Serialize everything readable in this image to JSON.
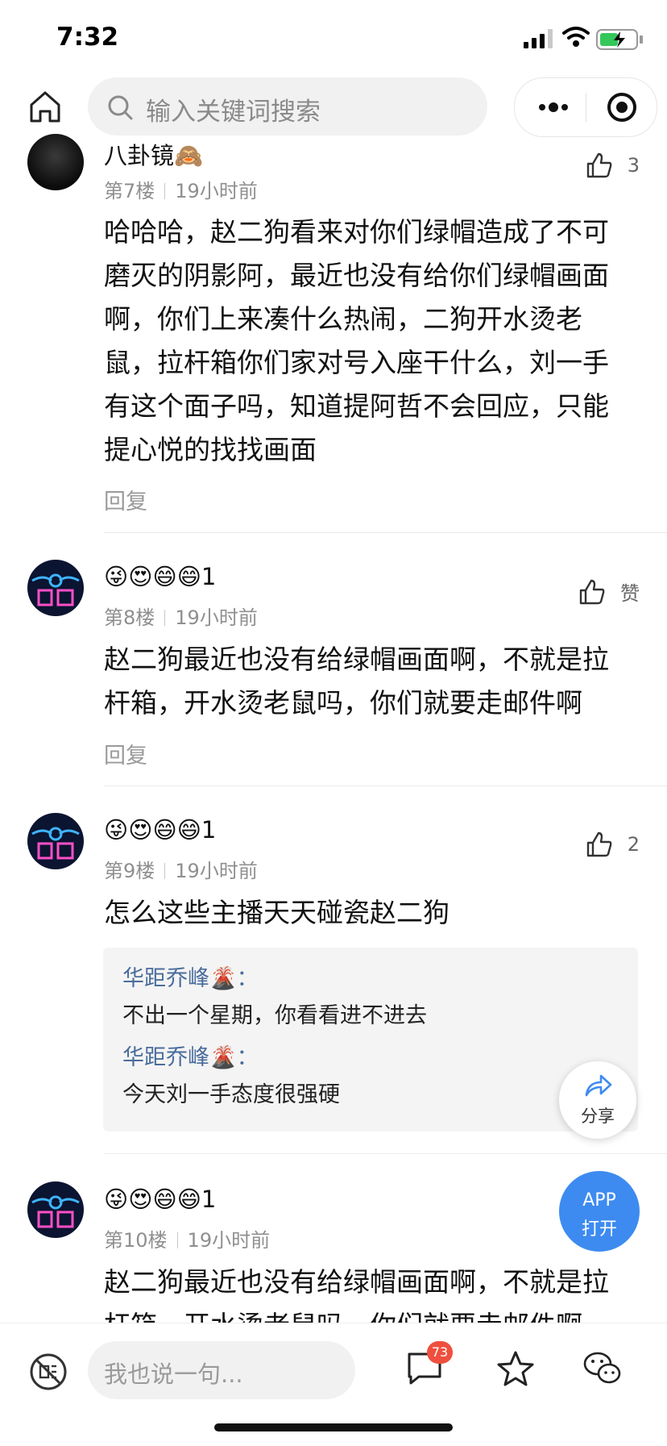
{
  "status_bar": {
    "time": "7:32"
  },
  "top_bar": {
    "search_placeholder": "输入关键词搜索"
  },
  "comments": [
    {
      "nickname": "八卦镜🙈",
      "floor": "第7楼",
      "time": "19小时前",
      "likes": "3",
      "text_lines": [
        "哈哈哈，赵二狗看来对你们绿帽造成了不可",
        "磨灭的阴影阿，最近也没有给你们绿帽画面",
        "啊，你们上来凑什么热闹，二狗开水烫老",
        "鼠，拉杆箱你们家对号入座干什么，刘一手",
        "有这个面子吗，知道提阿哲不会回应，只能",
        "提心悦的找找画面"
      ],
      "reply_label": "回复"
    },
    {
      "nickname": "😜😍😄😄1",
      "floor": "第8楼",
      "time": "19小时前",
      "likes": "赞",
      "text_lines": [
        "赵二狗最近也没有给绿帽画面啊，不就是拉",
        "杆箱，开水烫老鼠吗，你们就要走邮件啊"
      ],
      "reply_label": "回复"
    },
    {
      "nickname": "😜😍😄😄1",
      "floor": "第9楼",
      "time": "19小时前",
      "likes": "2",
      "text_lines": [
        "怎么这些主播天天碰瓷赵二狗"
      ],
      "sub_replies": [
        {
          "name": "华距乔峰🌋：",
          "text": "不出一个星期，你看看进不进去"
        },
        {
          "name": "华距乔峰🌋：",
          "text": "今天刘一手态度很强硬"
        }
      ]
    },
    {
      "nickname": "😜😍😄😄1",
      "floor": "第10楼",
      "time": "19小时前",
      "text_lines": [
        "赵二狗最近也没有给绿帽画面啊，不就是拉",
        "杆箱，开水烫老鼠吗，你们就要走邮件啊"
      ]
    }
  ],
  "floating": {
    "share_label": "分享",
    "app_line1": "APP",
    "app_line2": "打开"
  },
  "bottom_bar": {
    "input_placeholder": "我也说一句...",
    "comment_count": "73"
  },
  "colors": {
    "accent_blue": "#3d8bf0",
    "badge_red": "#ef4f3f",
    "sub_reply_name": "#4a6d9c"
  }
}
